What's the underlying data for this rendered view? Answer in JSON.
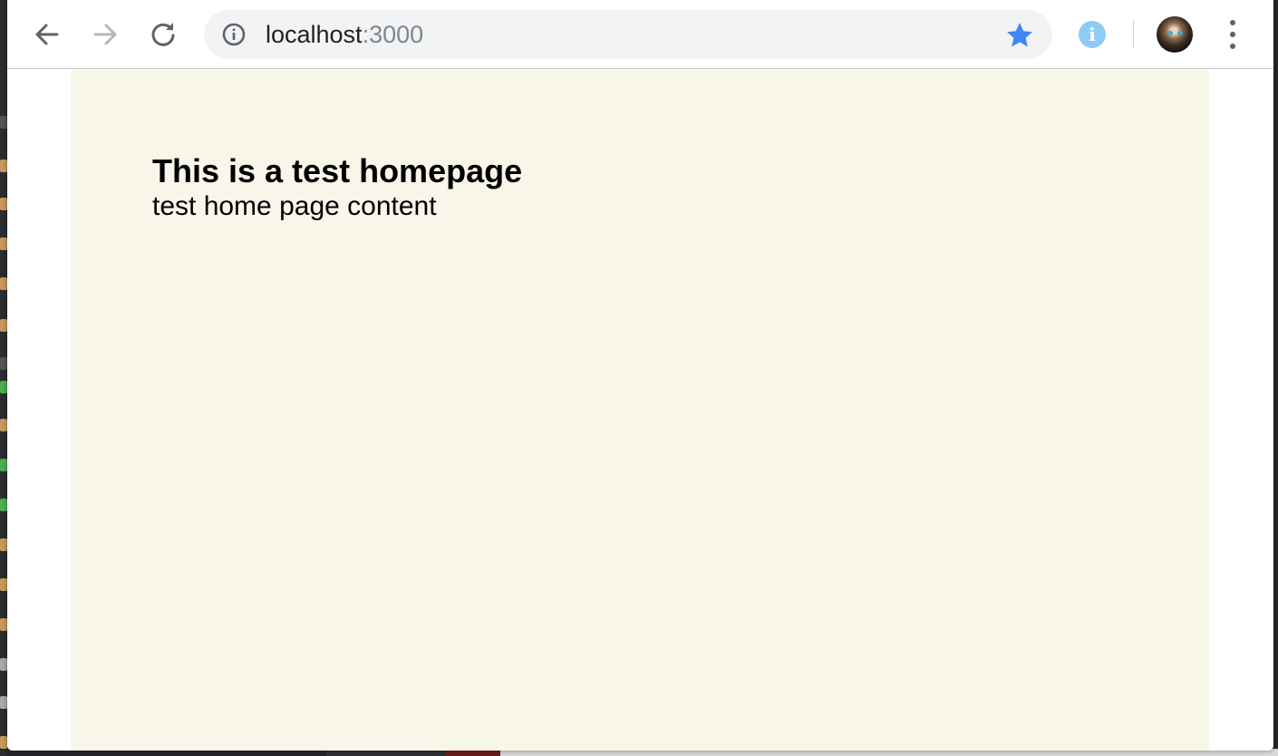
{
  "browser": {
    "address_bar": {
      "host": "localhost",
      "port": ":3000"
    },
    "icons": {
      "back": "arrow-left-icon",
      "forward": "arrow-right-icon",
      "reload": "reload-icon",
      "site_info": "info-circle-icon",
      "bookmark": "star-icon",
      "extension": "info-badge-icon",
      "menu": "kebab-menu-icon"
    },
    "extension_glyph": "i",
    "colors": {
      "bookmark_star": "#4285f4",
      "extension_badge": "#8ecbf5",
      "omnibox_bg": "#f1f3f4"
    }
  },
  "page": {
    "heading": "This is a test homepage",
    "content": "test home page content",
    "background": "#f8f6e9"
  }
}
